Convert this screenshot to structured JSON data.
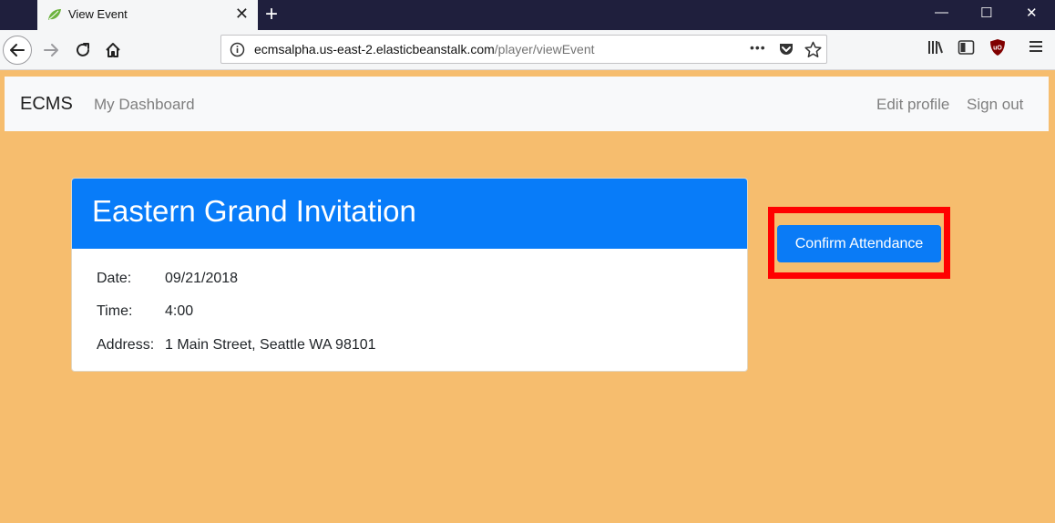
{
  "browser": {
    "tab_title": "View Event",
    "tab_close": "✕",
    "new_tab": "+",
    "window_controls": {
      "minimize": "—",
      "maximize": "☐",
      "close": "✕"
    },
    "url_host": "ecmsalpha.us-east-2.elasticbeanstalk.com",
    "url_path": "/player/viewEvent",
    "url_more": "•••",
    "icons": {
      "favicon": "spring-leaf-icon",
      "back": "back-arrow-icon",
      "forward": "forward-arrow-icon",
      "reload": "reload-icon",
      "home": "home-icon",
      "info": "info-icon",
      "pocket": "pocket-icon",
      "bookmark": "star-icon",
      "library": "library-icon",
      "sidebar": "sidebar-icon",
      "extension": "ublock-icon",
      "menu": "hamburger-menu-icon"
    }
  },
  "navbar": {
    "brand": "ECMS",
    "dashboard_link": "My Dashboard",
    "edit_profile_link": "Edit profile",
    "sign_out_link": "Sign out"
  },
  "event": {
    "title": "Eastern Grand Invitation",
    "date_label": "Date:",
    "date_value": "09/21/2018",
    "time_label": "Time:",
    "time_value": "4:00",
    "address_label": "Address:",
    "address_value": "1 Main Street, Seattle WA 98101"
  },
  "actions": {
    "confirm_label": "Confirm Attendance"
  },
  "colors": {
    "page_background": "#f6bd6e",
    "primary": "#087cf9",
    "highlight": "#ff0000",
    "navbar_background": "#f8f9fa"
  }
}
